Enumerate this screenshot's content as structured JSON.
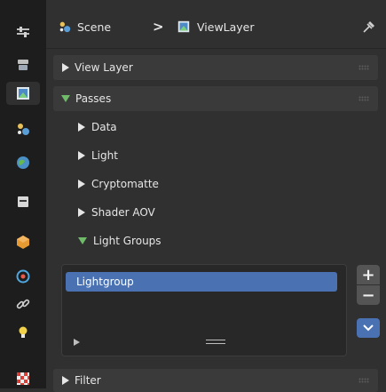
{
  "sidebar": {
    "tabs": [
      {
        "icon": "tool-icon",
        "active": false
      },
      {
        "icon": "render-icon",
        "active": false
      },
      {
        "icon": "output-icon",
        "active": false
      },
      {
        "icon": "view-layer-icon",
        "active": true
      },
      {
        "icon": "scene-icon",
        "active": false
      },
      {
        "icon": "world-icon",
        "active": false
      },
      {
        "icon": "collection-icon",
        "active": false
      },
      {
        "icon": "object-icon",
        "active": false
      },
      {
        "icon": "physics-icon",
        "active": false
      },
      {
        "icon": "constraints-icon",
        "active": false
      },
      {
        "icon": "object-data-icon",
        "active": false
      },
      {
        "icon": "texture-icon",
        "active": false
      }
    ]
  },
  "header": {
    "scene_label": "Scene",
    "separator": ">",
    "view_layer_label": "ViewLayer",
    "pin_icon": "pin-icon"
  },
  "panels": {
    "view_layer": {
      "label": "View Layer",
      "expanded": false
    },
    "passes": {
      "label": "Passes",
      "expanded": true
    },
    "filter": {
      "label": "Filter",
      "expanded": false
    }
  },
  "subpanels": {
    "data": {
      "label": "Data",
      "expanded": false
    },
    "light": {
      "label": "Light",
      "expanded": false
    },
    "cryptomatte": {
      "label": "Cryptomatte",
      "expanded": false
    },
    "shader_aov": {
      "label": "Shader AOV",
      "expanded": false
    },
    "light_groups": {
      "label": "Light Groups",
      "expanded": true
    }
  },
  "light_groups_list": {
    "items": [
      "Lightgroup"
    ],
    "add_label": "+",
    "remove_label": "−"
  },
  "colors": {
    "accent_blue": "#4a72b2",
    "expanded_triangle": "#6fbb6a",
    "panel_bg": "#303030",
    "sidebar_bg": "#1d1d1d"
  }
}
